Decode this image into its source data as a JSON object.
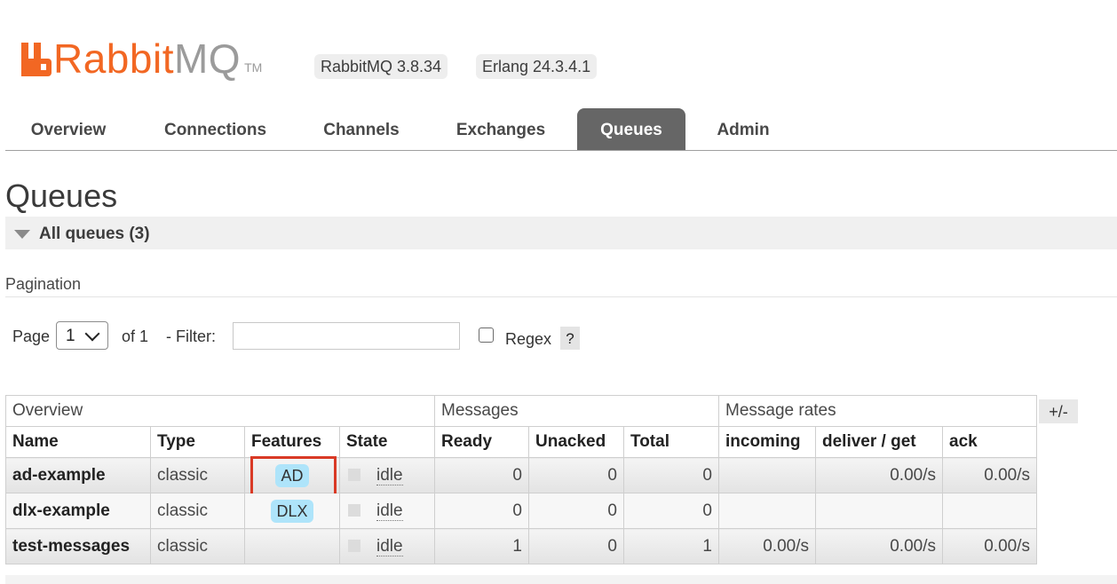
{
  "brand": {
    "name_primary": "Rabbit",
    "name_secondary": "MQ",
    "trademark": "TM",
    "accent_color": "#f26723"
  },
  "versions": {
    "rabbitmq": "RabbitMQ 3.8.34",
    "erlang": "Erlang 24.3.4.1"
  },
  "nav": {
    "tabs": [
      {
        "label": "Overview"
      },
      {
        "label": "Connections"
      },
      {
        "label": "Channels"
      },
      {
        "label": "Exchanges"
      },
      {
        "label": "Queues",
        "active": true
      },
      {
        "label": "Admin"
      }
    ]
  },
  "page": {
    "title": "Queues",
    "section_label": "All queues (3)"
  },
  "pagination": {
    "heading": "Pagination",
    "page_label": "Page",
    "page_value": "1",
    "of_label": "of 1",
    "filter_label": "- Filter:",
    "filter_value": "",
    "regex_label": "Regex",
    "regex_checked": false,
    "help_label": "?"
  },
  "table": {
    "groups": [
      "Overview",
      "Messages",
      "Message rates"
    ],
    "columns": [
      "Name",
      "Type",
      "Features",
      "State",
      "Ready",
      "Unacked",
      "Total",
      "incoming",
      "deliver / get",
      "ack"
    ],
    "toggle_label": "+/-",
    "rows": [
      {
        "name": "ad-example",
        "type": "classic",
        "feature": "AD",
        "state": "idle",
        "ready": "0",
        "unacked": "0",
        "total": "0",
        "incoming": "",
        "deliver_get": "0.00/s",
        "ack": "0.00/s"
      },
      {
        "name": "dlx-example",
        "type": "classic",
        "feature": "DLX",
        "state": "idle",
        "ready": "0",
        "unacked": "0",
        "total": "0",
        "incoming": "",
        "deliver_get": "",
        "ack": ""
      },
      {
        "name": "test-messages",
        "type": "classic",
        "feature": "",
        "state": "idle",
        "ready": "1",
        "unacked": "0",
        "total": "1",
        "incoming": "0.00/s",
        "deliver_get": "0.00/s",
        "ack": "0.00/s"
      }
    ]
  }
}
